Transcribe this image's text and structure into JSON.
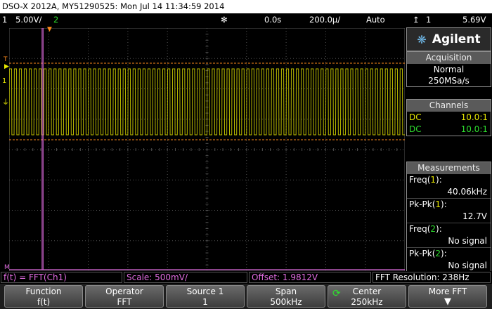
{
  "header": {
    "title": "DSO-X 2012A, MY51290525: Mon Jul 14 11:34:59 2014"
  },
  "status_bar": {
    "ch1_number": "1",
    "ch1_scale": "5.00V/",
    "ch2_number": "2",
    "time_offset": "0.0s",
    "time_scale": "200.0µ/",
    "trigger_mode": "Auto",
    "trigger_channel": "1",
    "trigger_level": "5.69V"
  },
  "panel": {
    "logo": "Agilent",
    "acquisition_title": "Acquisition",
    "acquisition_mode": "Normal",
    "sample_rate": "250MSa/s",
    "channels_title": "Channels",
    "channels": [
      {
        "coupling": "DC",
        "probe": "10.0:1",
        "color": "#e8e800"
      },
      {
        "coupling": "DC",
        "probe": "10.0:1",
        "color": "#2ee02e"
      }
    ],
    "measurements_title": "Measurements",
    "measurements": [
      {
        "prefix": "Freq(",
        "channel": "1",
        "suffix": "):",
        "value": "40.06kHz"
      },
      {
        "prefix": "Pk-Pk(",
        "channel": "1",
        "suffix": "):",
        "value": "12.7V"
      },
      {
        "prefix": "Freq(",
        "channel": "2",
        "suffix": "):",
        "value": "No signal"
      },
      {
        "prefix": "Pk-Pk(",
        "channel": "2",
        "suffix": "):",
        "value": "No signal"
      }
    ]
  },
  "math_bar": {
    "function": "f(t) = FFT(Ch1)",
    "scale": "Scale: 500mV/",
    "offset": "Offset: 1.9812V",
    "resolution": "FFT Resolution: 238Hz"
  },
  "softkeys": [
    {
      "label": "Function",
      "value": "f(t)"
    },
    {
      "label": "Operator",
      "value": "FFT"
    },
    {
      "label": "Source 1",
      "value": "1"
    },
    {
      "label": "Span",
      "value": "500kHz"
    },
    {
      "label": "Center",
      "value": "250kHz"
    },
    {
      "label": "More FFT",
      "value": ""
    }
  ],
  "colors": {
    "ch1": "#e8e800",
    "ch2": "#2ee02e",
    "math": "#e06ce0",
    "cursor_lines": "#ff8a1a",
    "grid": "#505050"
  },
  "trace": {
    "ch1_signal": "square wave",
    "ch1_frequency": "40.06kHz",
    "ch1_peak_to_peak": "12.7V",
    "fft_peak": "single spike near left edge"
  }
}
